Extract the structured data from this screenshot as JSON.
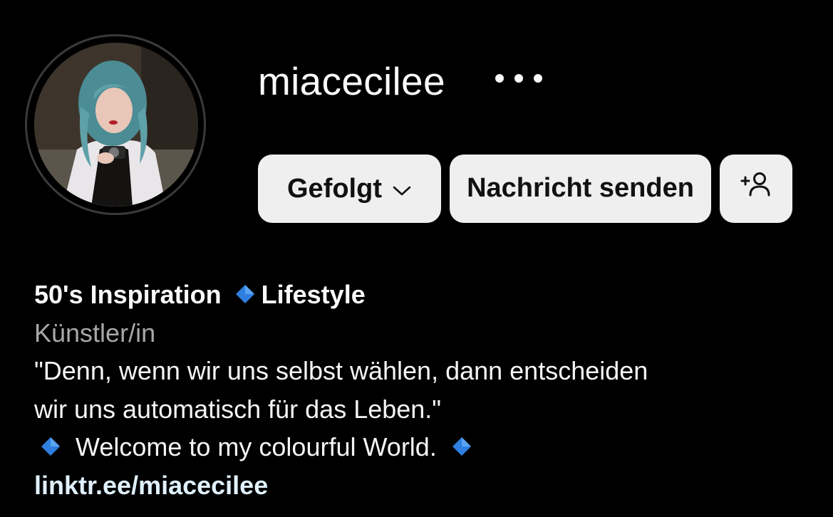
{
  "profile": {
    "username": "miacecilee",
    "avatar_alt": "profile-photo"
  },
  "actions": {
    "follow_label": "Gefolgt",
    "message_label": "Nachricht senden",
    "add_user_icon": "add-user-icon",
    "more_icon": "more-icon"
  },
  "bio": {
    "name_part1": "50's Inspiration",
    "name_part2": "Lifestyle",
    "category": "Künstler/in",
    "quote_line1": "\"Denn, wenn wir uns selbst wählen, dann entscheiden",
    "quote_line2": "wir uns automatisch für das Leben.\"",
    "welcome": "Welcome to my colourful World.",
    "link": "linktr.ee/miacecilee",
    "emoji_icon": "blue-diamond-icon"
  },
  "colors": {
    "background": "#000000",
    "button_bg": "#efefef",
    "link": "#e0f1ff",
    "category": "#a8a8a8",
    "diamond": "#2f7fe0"
  }
}
